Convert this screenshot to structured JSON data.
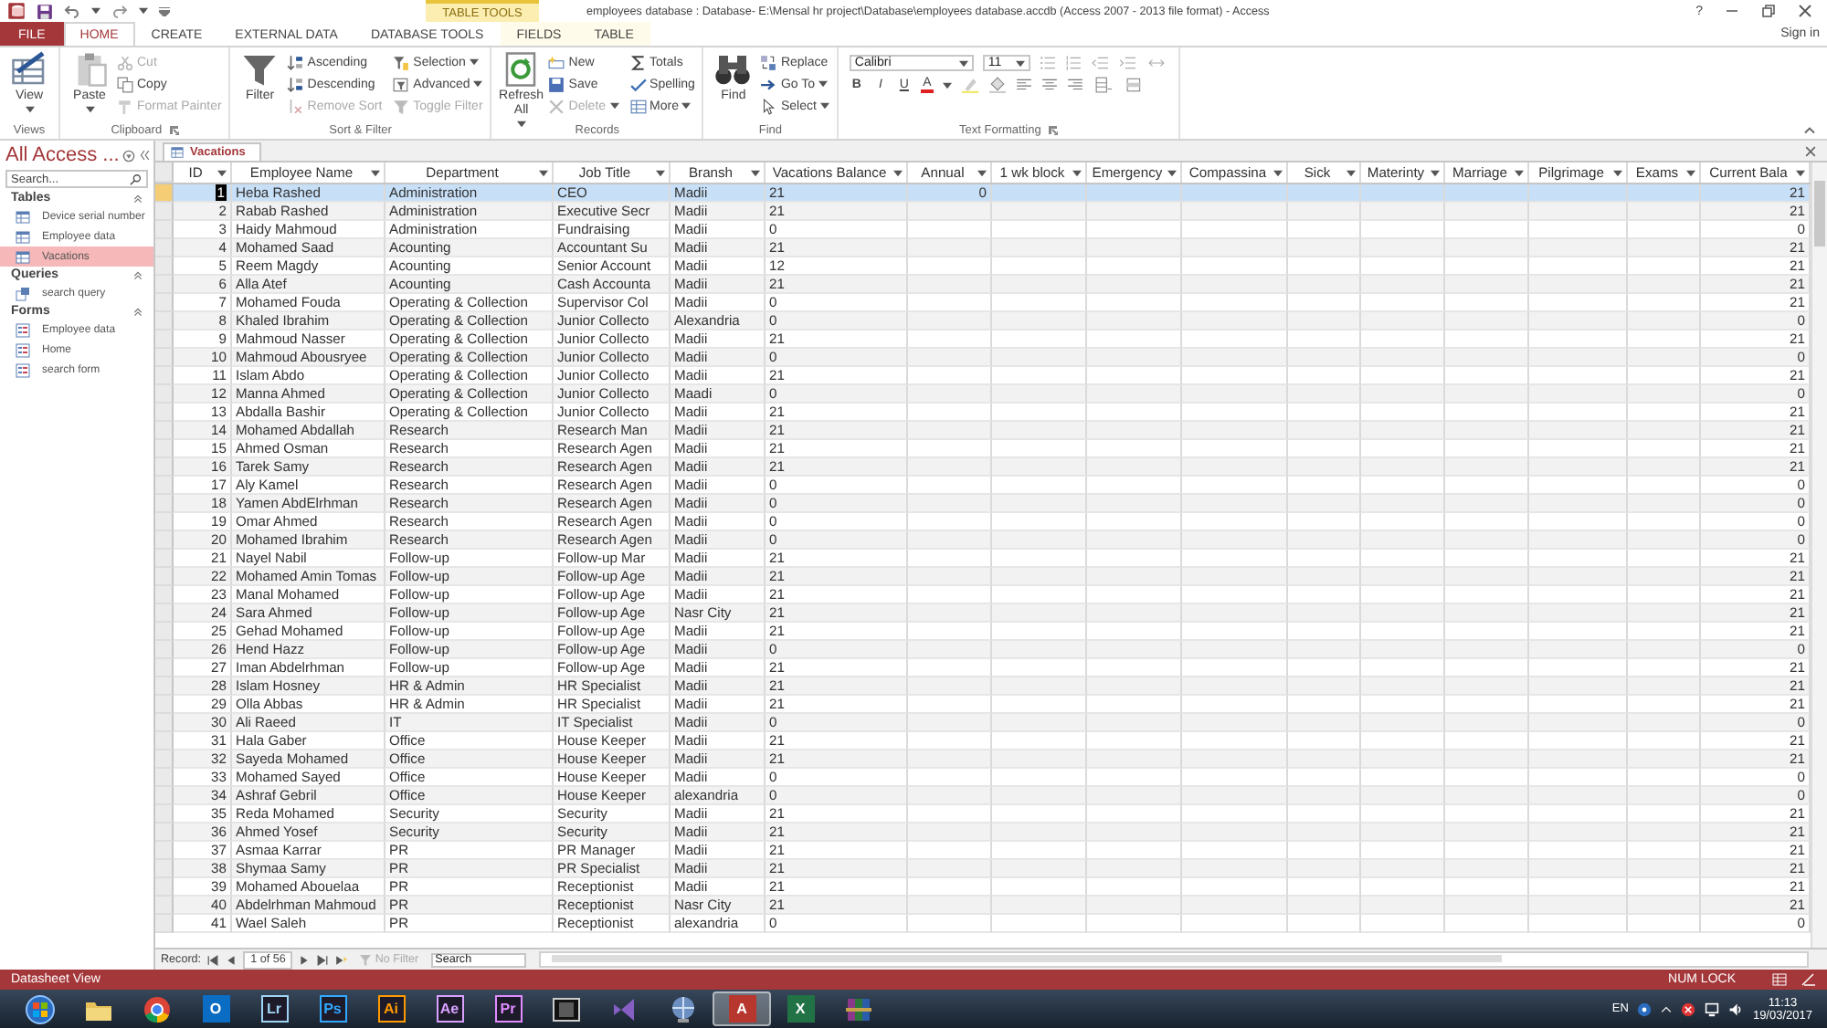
{
  "title_bar": {
    "title": "employees database : Database- E:\\Mensal hr project\\Database\\employees database.accdb (Access 2007 - 2013 file format) - Access",
    "help": "?",
    "sign_in": "Sign in"
  },
  "contextual_group": "TABLE TOOLS",
  "ribbon_tabs": [
    {
      "label": "FILE",
      "kind": "file",
      "selected": false
    },
    {
      "label": "HOME",
      "kind": "tab",
      "selected": true
    },
    {
      "label": "CREATE",
      "kind": "tab",
      "selected": false
    },
    {
      "label": "EXTERNAL DATA",
      "kind": "tab",
      "selected": false
    },
    {
      "label": "DATABASE TOOLS",
      "kind": "tab",
      "selected": false
    },
    {
      "label": "FIELDS",
      "kind": "contextual",
      "selected": false
    },
    {
      "label": "TABLE",
      "kind": "contextual",
      "selected": false
    }
  ],
  "ribbon_groups": [
    {
      "label": "Views",
      "launcher": false,
      "commands": [
        {
          "label": "View",
          "kind": "large",
          "menu": true,
          "disabled": false
        }
      ]
    },
    {
      "label": "Clipboard",
      "launcher": true,
      "commands": [
        {
          "label": "Paste",
          "kind": "large",
          "menu": true,
          "disabled": false
        },
        {
          "label": "Cut",
          "kind": "small",
          "menu": false,
          "disabled": true
        },
        {
          "label": "Copy",
          "kind": "small",
          "menu": false,
          "disabled": false
        },
        {
          "label": "Format Painter",
          "kind": "small",
          "menu": false,
          "disabled": true
        }
      ]
    },
    {
      "label": "Sort & Filter",
      "launcher": false,
      "commands": [
        {
          "label": "Filter",
          "kind": "large",
          "menu": false,
          "disabled": false
        },
        {
          "label": "Ascending",
          "kind": "small",
          "menu": false,
          "disabled": false
        },
        {
          "label": "Descending",
          "kind": "small",
          "menu": false,
          "disabled": false
        },
        {
          "label": "Remove Sort",
          "kind": "small",
          "menu": false,
          "disabled": true
        },
        {
          "label": "Selection",
          "kind": "small",
          "menu": true,
          "disabled": false
        },
        {
          "label": "Advanced",
          "kind": "small",
          "menu": true,
          "disabled": false
        },
        {
          "label": "Toggle Filter",
          "kind": "small",
          "menu": false,
          "disabled": true
        }
      ]
    },
    {
      "label": "Records",
      "launcher": false,
      "commands": [
        {
          "label": "Refresh All",
          "kind": "large",
          "menu": true,
          "disabled": false
        },
        {
          "label": "New",
          "kind": "small",
          "menu": false,
          "disabled": false
        },
        {
          "label": "Save",
          "kind": "small",
          "menu": false,
          "disabled": false
        },
        {
          "label": "Delete",
          "kind": "small",
          "menu": true,
          "disabled": true
        },
        {
          "label": "Totals",
          "kind": "small",
          "menu": false,
          "disabled": false
        },
        {
          "label": "Spelling",
          "kind": "small",
          "menu": false,
          "disabled": false
        },
        {
          "label": "More",
          "kind": "small",
          "menu": true,
          "disabled": false
        }
      ]
    },
    {
      "label": "Find",
      "launcher": false,
      "commands": [
        {
          "label": "Find",
          "kind": "large",
          "menu": false,
          "disabled": false
        },
        {
          "label": "Replace",
          "kind": "small",
          "menu": false,
          "disabled": false
        },
        {
          "label": "Go To",
          "kind": "small",
          "menu": true,
          "disabled": false
        },
        {
          "label": "Select",
          "kind": "small",
          "menu": true,
          "disabled": false
        }
      ]
    }
  ],
  "text_formatting": {
    "label": "Text Formatting",
    "launcher": true,
    "font": "Calibri",
    "size": "11",
    "style_buttons": [
      "B",
      "I",
      "U"
    ],
    "font_color_label": "A"
  },
  "navigation": {
    "title": "All Access ...",
    "search_placeholder": "Search...",
    "sections": [
      {
        "label": "Tables",
        "expanded": true,
        "items": [
          {
            "label": "Device serial number",
            "kind": "table",
            "selected": false
          },
          {
            "label": "Employee data",
            "kind": "table",
            "selected": false
          },
          {
            "label": "Vacations",
            "kind": "table",
            "selected": true
          }
        ]
      },
      {
        "label": "Queries",
        "expanded": true,
        "items": [
          {
            "label": "search query",
            "kind": "query",
            "selected": false
          }
        ]
      },
      {
        "label": "Forms",
        "expanded": true,
        "items": [
          {
            "label": "Employee data",
            "kind": "form",
            "selected": false
          },
          {
            "label": "Home",
            "kind": "form",
            "selected": false
          },
          {
            "label": "search form",
            "kind": "form",
            "selected": false
          }
        ]
      }
    ]
  },
  "document_tabs": [
    {
      "label": "Vacations",
      "selected": true
    }
  ],
  "datasheet": {
    "columns": [
      {
        "label": "ID",
        "kind": "number"
      },
      {
        "label": "Employee Name",
        "kind": "text"
      },
      {
        "label": "Department",
        "kind": "text"
      },
      {
        "label": "Job Title",
        "kind": "text"
      },
      {
        "label": "Bransh",
        "kind": "text"
      },
      {
        "label": "Vacations Balance",
        "kind": "text"
      },
      {
        "label": "Annual",
        "kind": "number"
      },
      {
        "label": "1 wk block",
        "kind": "number"
      },
      {
        "label": "Emergency",
        "kind": "number"
      },
      {
        "label": "Compassina",
        "kind": "number"
      },
      {
        "label": "Sick",
        "kind": "number"
      },
      {
        "label": "Materinty",
        "kind": "number"
      },
      {
        "label": "Marriage",
        "kind": "number"
      },
      {
        "label": "Pilgrimage",
        "kind": "number"
      },
      {
        "label": "Exams",
        "kind": "number"
      },
      {
        "label": "Current Bala",
        "kind": "number"
      }
    ],
    "rows": [
      {
        "selected": true,
        "id": "1",
        "name": "Heba Rashed",
        "department": "Administration",
        "job_title": "CEO",
        "branch": "Madii",
        "vacations_balance": "21",
        "annual": "0",
        "current_balance": "21"
      },
      {
        "selected": false,
        "id": "2",
        "name": "Rabab Rashed",
        "department": "Administration",
        "job_title": "Executive Secr",
        "branch": "Madii",
        "vacations_balance": "21",
        "current_balance": "21"
      },
      {
        "selected": false,
        "id": "3",
        "name": "Haidy Mahmoud",
        "department": "Administration",
        "job_title": "Fundraising",
        "branch": "Madii",
        "vacations_balance": "0",
        "current_balance": "0"
      },
      {
        "selected": false,
        "id": "4",
        "name": "Mohamed Saad",
        "department": "Acounting",
        "job_title": "Accountant Su",
        "branch": "Madii",
        "vacations_balance": "21",
        "current_balance": "21"
      },
      {
        "selected": false,
        "id": "5",
        "name": "Reem Magdy",
        "department": "Acounting",
        "job_title": "Senior Account",
        "branch": "Madii",
        "vacations_balance": "12",
        "current_balance": "21"
      },
      {
        "selected": false,
        "id": "6",
        "name": "Alla Atef",
        "department": "Acounting",
        "job_title": "Cash Accounta",
        "branch": "Madii",
        "vacations_balance": "21",
        "current_balance": "21"
      },
      {
        "selected": false,
        "id": "7",
        "name": "Mohamed Fouda",
        "department": "Operating & Collection",
        "job_title": "Supervisor Col",
        "branch": "Madii",
        "vacations_balance": "0",
        "current_balance": "21"
      },
      {
        "selected": false,
        "id": "8",
        "name": "Khaled Ibrahim",
        "department": "Operating & Collection",
        "job_title": "Junior Collecto",
        "branch": "Alexandria",
        "vacations_balance": "0",
        "current_balance": "0"
      },
      {
        "selected": false,
        "id": "9",
        "name": "Mahmoud Nasser",
        "department": "Operating & Collection",
        "job_title": "Junior Collecto",
        "branch": "Madii",
        "vacations_balance": "21",
        "current_balance": "21"
      },
      {
        "selected": false,
        "id": "10",
        "name": "Mahmoud Abousryee",
        "department": "Operating & Collection",
        "job_title": "Junior Collecto",
        "branch": "Madii",
        "vacations_balance": "0",
        "current_balance": "0"
      },
      {
        "selected": false,
        "id": "11",
        "name": "Islam Abdo",
        "department": "Operating & Collection",
        "job_title": "Junior Collecto",
        "branch": "Madii",
        "vacations_balance": "21",
        "current_balance": "21"
      },
      {
        "selected": false,
        "id": "12",
        "name": "Manna Ahmed",
        "department": "Operating & Collection",
        "job_title": "Junior Collecto",
        "branch": "Maadi",
        "vacations_balance": "0",
        "current_balance": "0"
      },
      {
        "selected": false,
        "id": "13",
        "name": "Abdalla Bashir",
        "department": "Operating & Collection",
        "job_title": "Junior Collecto",
        "branch": "Madii",
        "vacations_balance": "21",
        "current_balance": "21"
      },
      {
        "selected": false,
        "id": "14",
        "name": "Mohamed Abdallah",
        "department": "Research",
        "job_title": "Research Man",
        "branch": "Madii",
        "vacations_balance": "21",
        "current_balance": "21"
      },
      {
        "selected": false,
        "id": "15",
        "name": "Ahmed Osman",
        "department": "Research",
        "job_title": "Research Agen",
        "branch": "Madii",
        "vacations_balance": "21",
        "current_balance": "21"
      },
      {
        "selected": false,
        "id": "16",
        "name": "Tarek Samy",
        "department": "Research",
        "job_title": "Research Agen",
        "branch": "Madii",
        "vacations_balance": "21",
        "current_balance": "21"
      },
      {
        "selected": false,
        "id": "17",
        "name": "Aly Kamel",
        "department": "Research",
        "job_title": "Research Agen",
        "branch": "Madii",
        "vacations_balance": "0",
        "current_balance": "0"
      },
      {
        "selected": false,
        "id": "18",
        "name": "Yamen AbdElrhman",
        "department": "Research",
        "job_title": "Research Agen",
        "branch": "Madii",
        "vacations_balance": "0",
        "current_balance": "0"
      },
      {
        "selected": false,
        "id": "19",
        "name": "Omar Ahmed",
        "department": "Research",
        "job_title": "Research Agen",
        "branch": "Madii",
        "vacations_balance": "0",
        "current_balance": "0"
      },
      {
        "selected": false,
        "id": "20",
        "name": "Mohamed Ibrahim",
        "department": "Research",
        "job_title": "Research Agen",
        "branch": "Madii",
        "vacations_balance": "0",
        "current_balance": "0"
      },
      {
        "selected": false,
        "id": "21",
        "name": "Nayel Nabil",
        "department": "Follow-up",
        "job_title": "Follow-up Mar",
        "branch": "Madii",
        "vacations_balance": "21",
        "current_balance": "21"
      },
      {
        "selected": false,
        "id": "22",
        "name": "Mohamed Amin Tomas",
        "department": "Follow-up",
        "job_title": "Follow-up Age",
        "branch": "Madii",
        "vacations_balance": "21",
        "current_balance": "21"
      },
      {
        "selected": false,
        "id": "23",
        "name": "Manal Mohamed",
        "department": "Follow-up",
        "job_title": "Follow-up Age",
        "branch": "Madii",
        "vacations_balance": "21",
        "current_balance": "21"
      },
      {
        "selected": false,
        "id": "24",
        "name": "Sara Ahmed",
        "department": "Follow-up",
        "job_title": "Follow-up Age",
        "branch": "Nasr City",
        "vacations_balance": "21",
        "current_balance": "21"
      },
      {
        "selected": false,
        "id": "25",
        "name": "Gehad Mohamed",
        "department": "Follow-up",
        "job_title": "Follow-up Age",
        "branch": "Madii",
        "vacations_balance": "21",
        "current_balance": "21"
      },
      {
        "selected": false,
        "id": "26",
        "name": "Hend Hazz",
        "department": "Follow-up",
        "job_title": "Follow-up Age",
        "branch": "Madii",
        "vacations_balance": "0",
        "current_balance": "0"
      },
      {
        "selected": false,
        "id": "27",
        "name": "Iman Abdelrhman",
        "department": "Follow-up",
        "job_title": "Follow-up Age",
        "branch": "Madii",
        "vacations_balance": "21",
        "current_balance": "21"
      },
      {
        "selected": false,
        "id": "28",
        "name": "Islam Hosney",
        "department": "HR & Admin",
        "job_title": "HR Specialist",
        "branch": "Madii",
        "vacations_balance": "21",
        "current_balance": "21"
      },
      {
        "selected": false,
        "id": "29",
        "name": "Olla Abbas",
        "department": "HR & Admin",
        "job_title": "HR Specialist",
        "branch": "Madii",
        "vacations_balance": "21",
        "current_balance": "21"
      },
      {
        "selected": false,
        "id": "30",
        "name": "Ali Raeed",
        "department": "IT",
        "job_title": "IT Specialist",
        "branch": "Madii",
        "vacations_balance": "0",
        "current_balance": "0"
      },
      {
        "selected": false,
        "id": "31",
        "name": "Hala Gaber",
        "department": "Office",
        "job_title": "House Keeper",
        "branch": "Madii",
        "vacations_balance": "21",
        "current_balance": "21"
      },
      {
        "selected": false,
        "id": "32",
        "name": "Sayeda Mohamed",
        "department": "Office",
        "job_title": "House Keeper",
        "branch": "Madii",
        "vacations_balance": "21",
        "current_balance": "21"
      },
      {
        "selected": false,
        "id": "33",
        "name": "Mohamed  Sayed",
        "department": "Office",
        "job_title": "House Keeper",
        "branch": "Madii",
        "vacations_balance": "0",
        "current_balance": "0"
      },
      {
        "selected": false,
        "id": "34",
        "name": "Ashraf  Gebril",
        "department": "Office",
        "job_title": "House Keeper",
        "branch": "alexandria",
        "vacations_balance": "0",
        "current_balance": "0"
      },
      {
        "selected": false,
        "id": "35",
        "name": "Reda Mohamed",
        "department": "Security",
        "job_title": "Security",
        "branch": "Madii",
        "vacations_balance": "21",
        "current_balance": "21"
      },
      {
        "selected": false,
        "id": "36",
        "name": "Ahmed Yosef",
        "department": "Security",
        "job_title": "Security",
        "branch": "Madii",
        "vacations_balance": "21",
        "current_balance": "21"
      },
      {
        "selected": false,
        "id": "37",
        "name": "Asmaa Karrar",
        "department": "PR",
        "job_title": "PR Manager",
        "branch": "Madii",
        "vacations_balance": "21",
        "current_balance": "21"
      },
      {
        "selected": false,
        "id": "38",
        "name": "Shymaa Samy",
        "department": "PR",
        "job_title": "PR Specialist",
        "branch": "Madii",
        "vacations_balance": "21",
        "current_balance": "21"
      },
      {
        "selected": false,
        "id": "39",
        "name": "Mohamed Abouelaa",
        "department": "PR",
        "job_title": "Receptionist",
        "branch": "Madii",
        "vacations_balance": "21",
        "current_balance": "21"
      },
      {
        "selected": false,
        "id": "40",
        "name": "Abdelrhman Mahmoud",
        "department": "PR",
        "job_title": "Receptionist",
        "branch": "Nasr City",
        "vacations_balance": "21",
        "current_balance": "21"
      },
      {
        "selected": false,
        "id": "41",
        "name": "Wael Saleh",
        "department": "PR",
        "job_title": "Receptionist",
        "branch": "alexandria",
        "vacations_balance": "0",
        "current_balance": "0"
      }
    ]
  },
  "record_navigator": {
    "label": "Record:",
    "position": "1 of 56",
    "filter": "No Filter",
    "filter_active": false,
    "search_placeholder": "Search"
  },
  "status_bar": {
    "view": "Datasheet View",
    "indicators": [
      "NUM LOCK"
    ]
  },
  "taskbar": {
    "apps": [
      {
        "kind": "start",
        "selected": false
      },
      {
        "kind": "folder",
        "selected": false
      },
      {
        "kind": "browser",
        "selected": false
      },
      {
        "kind": "office",
        "label": "O",
        "color": "#0a6cc2",
        "selected": false
      },
      {
        "kind": "adobe",
        "label": "Lr",
        "color": "#9fd3f5",
        "selected": false
      },
      {
        "kind": "adobe",
        "label": "Ps",
        "color": "#31a8ff",
        "selected": false
      },
      {
        "kind": "adobe",
        "label": "Ai",
        "color": "#ff9a00",
        "selected": false
      },
      {
        "kind": "adobe",
        "label": "Ae",
        "color": "#d8a0ff",
        "selected": false
      },
      {
        "kind": "adobe",
        "label": "Pr",
        "color": "#e08cff",
        "selected": false
      },
      {
        "kind": "film",
        "selected": false
      },
      {
        "kind": "studio",
        "selected": false
      },
      {
        "kind": "network",
        "selected": false
      },
      {
        "kind": "office",
        "label": "A",
        "color": "#b7372f",
        "selected": true
      },
      {
        "kind": "office",
        "label": "X",
        "color": "#217346",
        "selected": false
      },
      {
        "kind": "archive",
        "selected": false
      }
    ],
    "tray": {
      "language": "EN",
      "time": "11:13",
      "date": "19/03/2017"
    }
  }
}
